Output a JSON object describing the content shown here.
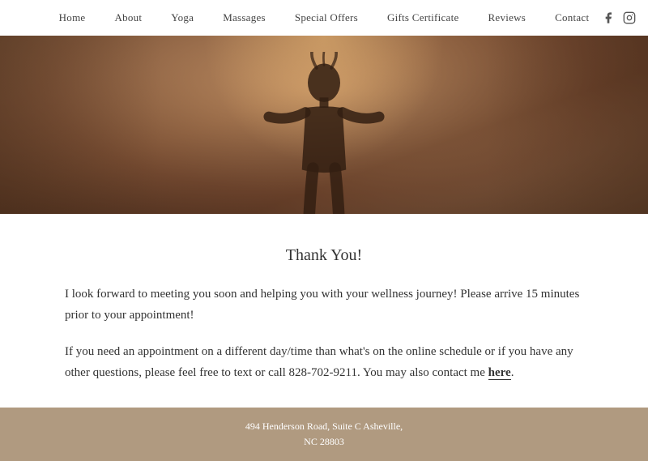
{
  "nav": {
    "links": [
      {
        "label": "Home",
        "name": "home"
      },
      {
        "label": "About",
        "name": "about"
      },
      {
        "label": "Yoga",
        "name": "yoga"
      },
      {
        "label": "Massages",
        "name": "massages"
      },
      {
        "label": "Special Offers",
        "name": "special-offers"
      },
      {
        "label": "Gifts Certificate",
        "name": "gifts-certificate"
      },
      {
        "label": "Reviews",
        "name": "reviews"
      },
      {
        "label": "Contact",
        "name": "contact"
      }
    ],
    "social": [
      {
        "label": "Facebook",
        "name": "facebook",
        "icon": "f"
      },
      {
        "label": "Instagram",
        "name": "instagram",
        "icon": "📷"
      }
    ]
  },
  "content": {
    "title": "Thank You!",
    "paragraph1": "I look forward to meeting you soon and helping you with your wellness journey! Please arrive 15 minutes prior to your appointment!",
    "paragraph2_start": "If you need an appointment on a different day/time than what's on the online schedule or if you have any other questions, please feel free to text or call 828-702-9211. You may also contact me ",
    "paragraph2_link": "here",
    "paragraph2_end": "."
  },
  "footer": {
    "line1": "494 Henderson Road, Suite C Asheville,",
    "line2": "NC 28803"
  }
}
